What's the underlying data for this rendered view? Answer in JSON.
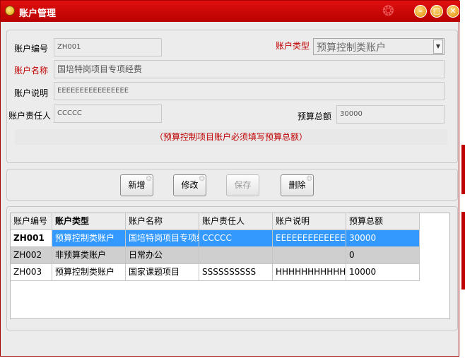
{
  "window": {
    "title": "账户管理"
  },
  "form": {
    "account_no": {
      "label": "账户编号",
      "value": "ZH001"
    },
    "account_type": {
      "label": "账户类型",
      "value": "预算控制类账户"
    },
    "account_name": {
      "label": "账户名称",
      "value": "国培特岗项目专项经费"
    },
    "account_desc": {
      "label": "账户说明",
      "value": "EEEEEEEEEEEEEEEE"
    },
    "owner": {
      "label": "账户责任人",
      "value": "CCCCC"
    },
    "budget": {
      "label": "预算总额",
      "value": "30000"
    },
    "hint": "（预算控制项目账户必须填写预算总额）"
  },
  "toolbar": {
    "new_label": "新增",
    "edit_label": "修改",
    "save_label": "保存",
    "delete_label": "删除"
  },
  "table": {
    "headers": [
      "账户编号",
      "账户类型",
      "账户名称",
      "账户责任人",
      "账户说明",
      "预算总额"
    ],
    "rows": [
      [
        "ZH001",
        "预算控制类账户",
        "国培特岗项目专项经费",
        "CCCCC",
        "EEEEEEEEEEEEEEEE",
        "30000"
      ],
      [
        "ZH002",
        "非预算类账户",
        "日常办公",
        "",
        "",
        "0"
      ],
      [
        "ZH003",
        "预算控制类账户",
        "国家课题项目",
        "SSSSSSSSSS",
        "HHHHHHHHHHHHH",
        "10000"
      ]
    ]
  },
  "colors": {
    "titlebar": "#c00000",
    "selection": "#3399ff",
    "required_label": "#c00000"
  }
}
